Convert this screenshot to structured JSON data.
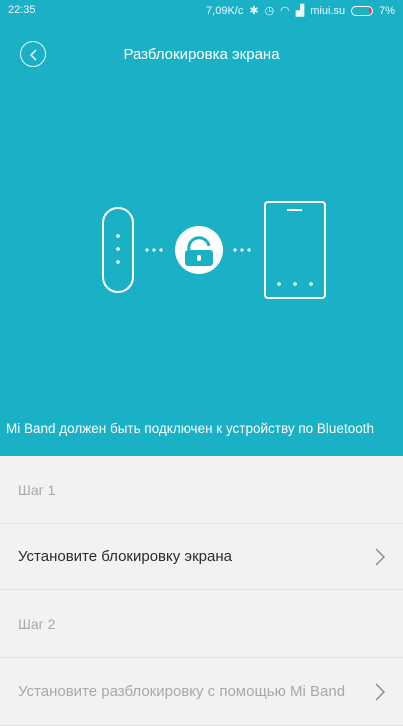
{
  "status_bar": {
    "time": "22:35",
    "speed": "7,09K/c",
    "carrier": "miui.su",
    "battery": "7%"
  },
  "header": {
    "title": "Разблокировка экрана",
    "back_icon": "chevron-left-icon"
  },
  "hero": {
    "caption": "Mi Band должен быть подключен к устройству по Bluetooth",
    "background": "#1ab1c6"
  },
  "steps": [
    {
      "label": "Шаг 1",
      "action": "Установите блокировку экрана",
      "enabled": true
    },
    {
      "label": "Шаг 2",
      "action": "Установите разблокировку с помощью Mi Band",
      "enabled": false
    }
  ],
  "colors": {
    "accent": "#1ab1c6",
    "list_background": "#f2f2f2",
    "disabled_text": "#a8a8a8"
  }
}
